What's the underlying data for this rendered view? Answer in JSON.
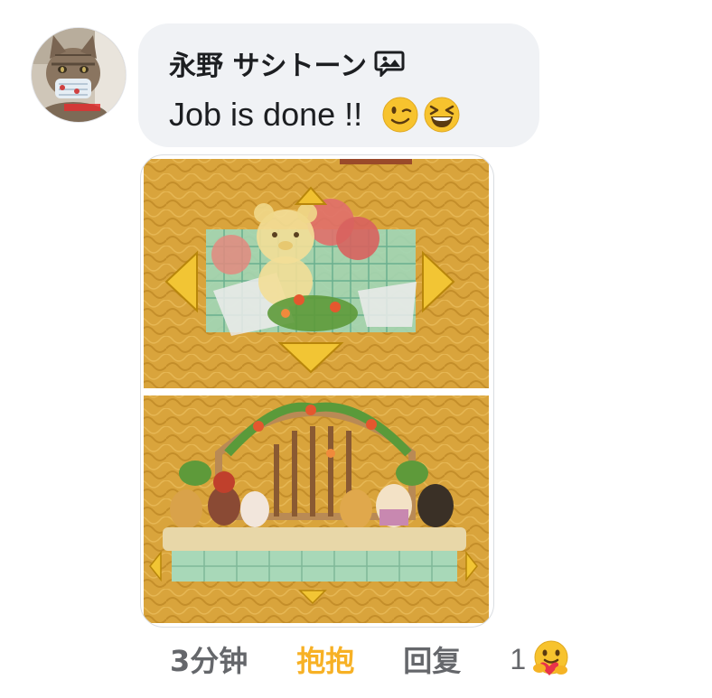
{
  "comment": {
    "author_name": "永野 サシトーン",
    "author_badge_icon": "image-chat-icon",
    "text": "Job is done !!",
    "emojis": [
      "winking-face",
      "grinning-squinting-face"
    ],
    "avatar_icon": "cat-avatar-with-mask"
  },
  "attachment": {
    "description_icon": "pixel-art-game-screenshot",
    "panels": [
      "teddy-bear-placement-preview",
      "garden-gate-with-plush-animals"
    ]
  },
  "actions": {
    "timestamp": "3分钟",
    "reaction_label": "抱抱",
    "reply_label": "回复",
    "reaction_count": "1",
    "reaction_icon": "care-hug-emoji"
  },
  "colors": {
    "bubble_bg": "#f0f2f5",
    "reaction_active": "#f7b125",
    "secondary_text": "#65676b",
    "primary_text": "#1c1e21"
  }
}
